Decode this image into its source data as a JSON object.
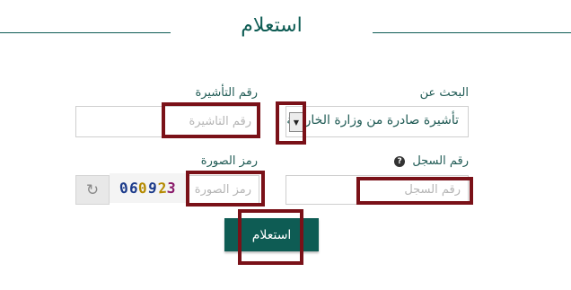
{
  "page": {
    "title": "استعلام"
  },
  "form": {
    "search_by": {
      "label": "البحث عن",
      "selected": "تأشيرة صادرة من وزارة الخارجية"
    },
    "visa_number": {
      "label": "رقم التأشيرة",
      "placeholder": "رقم التأشيرة"
    },
    "record_number": {
      "label": "رقم السجل",
      "placeholder": "رقم السجل",
      "info_icon": "info-icon"
    },
    "captcha": {
      "label": "رمز الصورة",
      "placeholder": "رمز الصورة",
      "image_text": [
        "0",
        "6",
        "0",
        "9",
        "2",
        "3"
      ],
      "image_colors": [
        "#1b3a8a",
        "#1b3a8a",
        "#b58a00",
        "#1b3a8a",
        "#b58a00",
        "#8a1a6a"
      ],
      "refresh_icon": "refresh-icon"
    },
    "submit_label": "استعلام"
  },
  "colors": {
    "accent": "#0e5c54",
    "highlight": "#7a1118"
  }
}
